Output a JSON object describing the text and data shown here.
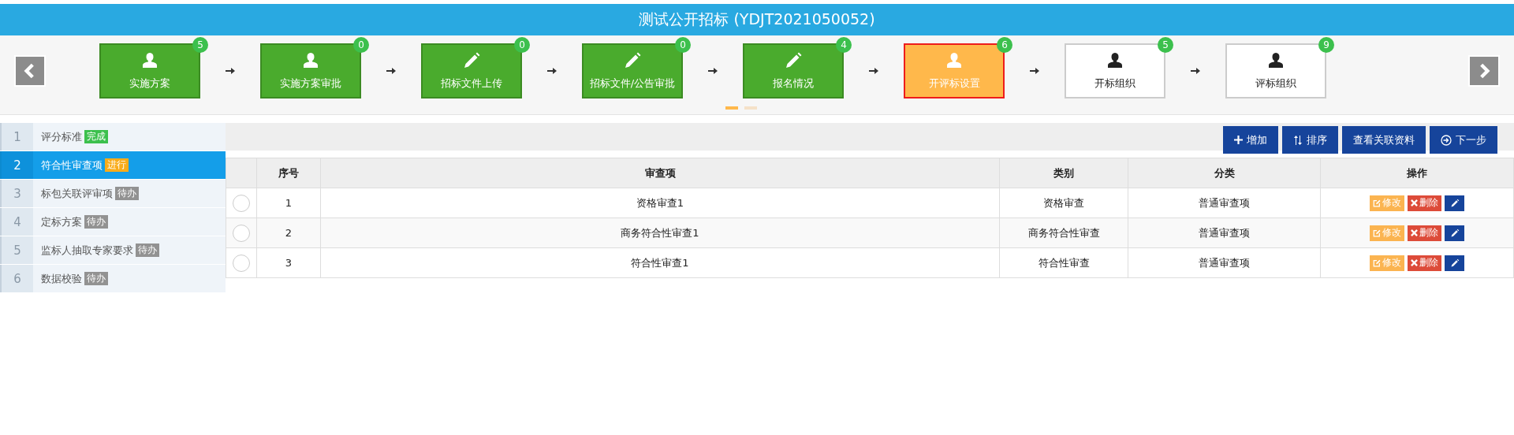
{
  "header": {
    "title": "测试公开招标 (YDJT2021050052)"
  },
  "steps": [
    {
      "label": "实施方案",
      "count": "5",
      "kind": "person",
      "done": true,
      "selected": false
    },
    {
      "label": "实施方案审批",
      "count": "0",
      "kind": "person",
      "done": true,
      "selected": false
    },
    {
      "label": "招标文件上传",
      "count": "0",
      "kind": "pencil",
      "done": true,
      "selected": false
    },
    {
      "label": "招标文件/公告审批",
      "count": "0",
      "kind": "pencil",
      "done": true,
      "selected": false
    },
    {
      "label": "报名情况",
      "count": "4",
      "kind": "pencil",
      "done": true,
      "selected": false
    },
    {
      "label": "开评标设置",
      "count": "6",
      "kind": "person",
      "done": false,
      "selected": true
    },
    {
      "label": "开标组织",
      "count": "5",
      "kind": "person",
      "done": false,
      "selected": false
    },
    {
      "label": "评标组织",
      "count": "9",
      "kind": "person",
      "done": false,
      "selected": false
    }
  ],
  "pager": [
    {
      "selected": true
    },
    {
      "selected": false
    }
  ],
  "sidebar": {
    "items": [
      {
        "number": "1",
        "label": "评分标准",
        "tag": "完成",
        "color": "#3cc04d",
        "selected": false
      },
      {
        "number": "2",
        "label": "符合性审查项",
        "tag": "进行",
        "color": "#f9ac1a",
        "selected": true
      },
      {
        "number": "3",
        "label": "标包关联评审项",
        "tag": "待办",
        "color": "#929292",
        "selected": false
      },
      {
        "number": "4",
        "label": "定标方案",
        "tag": "待办",
        "color": "#929292",
        "selected": false
      },
      {
        "number": "5",
        "label": "监标人抽取专家要求",
        "tag": "待办",
        "color": "#929292",
        "selected": false
      },
      {
        "number": "6",
        "label": "数据校验",
        "tag": "待办",
        "color": "#929292",
        "selected": false
      }
    ]
  },
  "toolbar": [
    {
      "label": "增加",
      "kind": "plus"
    },
    {
      "label": "排序",
      "kind": "sort"
    },
    {
      "label": "查看关联资料",
      "kind": "text"
    },
    {
      "label": "下一步",
      "kind": "next"
    }
  ],
  "table": {
    "columns": [
      "序号",
      "审查项",
      "类别",
      "分类",
      "操作"
    ],
    "rows": [
      {
        "selected": false,
        "cells": [
          "1",
          "资格审查1",
          "资格审查",
          "普通审查项"
        ],
        "edit": "修改",
        "delete": "删除"
      },
      {
        "selected": false,
        "cells": [
          "2",
          "商务符合性审查1",
          "商务符合性审查",
          "普通审查项"
        ],
        "edit": "修改",
        "delete": "删除"
      },
      {
        "selected": false,
        "cells": [
          "3",
          "符合性审查1",
          "符合性审查",
          "普通审查项"
        ],
        "edit": "修改",
        "delete": "删除"
      }
    ]
  }
}
